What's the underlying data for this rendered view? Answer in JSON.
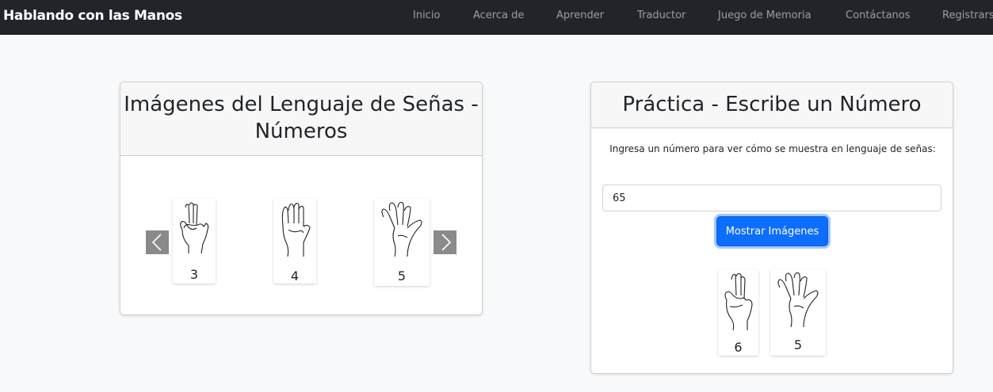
{
  "navbar": {
    "brand": "Hablando con las Manos",
    "links": [
      "Inicio",
      "Acerca de",
      "Aprender",
      "Traductor",
      "Juego de Memoria",
      "Contáctanos",
      "Registrarse"
    ]
  },
  "gallery": {
    "title": "Imágenes del Lenguaje de Señas - Números",
    "items": [
      {
        "number": "3",
        "icon": "hand-sign-three-icon"
      },
      {
        "number": "4",
        "icon": "hand-sign-four-icon"
      },
      {
        "number": "5",
        "icon": "hand-sign-five-icon"
      }
    ],
    "prev_icon": "chevron-left-icon",
    "next_icon": "chevron-right-icon"
  },
  "practice": {
    "title": "Práctica - Escribe un Número",
    "instructions": "Ingresa un número para ver cómo se muestra en lenguaje de señas:",
    "input_value": "65",
    "button_label": "Mostrar Imágenes",
    "results": [
      {
        "number": "6",
        "icon": "hand-sign-six-icon"
      },
      {
        "number": "5",
        "icon": "hand-sign-five-icon"
      }
    ]
  },
  "colors": {
    "navbar_bg": "#212529",
    "page_bg": "#f8f9fa",
    "primary": "#0d6efd",
    "arrow_bg": "#8a8a8a"
  }
}
